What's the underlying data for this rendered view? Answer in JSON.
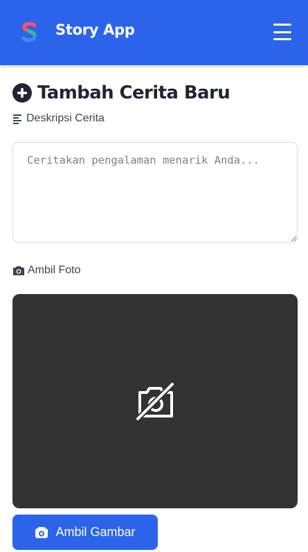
{
  "header": {
    "app_title": "Story App",
    "logo_icon": "story-app-logo",
    "menu_icon": "hamburger-icon",
    "background_color": "#2b64ea"
  },
  "main": {
    "page_title": "Tambah Cerita Baru",
    "page_title_icon": "plus-circle-icon",
    "description": {
      "label": "Deskripsi Cerita",
      "icon": "align-left-icon",
      "value": "",
      "placeholder": "Ceritakan pengalaman menarik Anda..."
    },
    "photo": {
      "label": "Ambil Foto",
      "icon": "camera-icon",
      "preview_icon": "camera-off-icon",
      "preview_background": "#333333",
      "capture_button_label": "Ambil Gambar",
      "capture_button_icon": "camera-icon"
    }
  }
}
